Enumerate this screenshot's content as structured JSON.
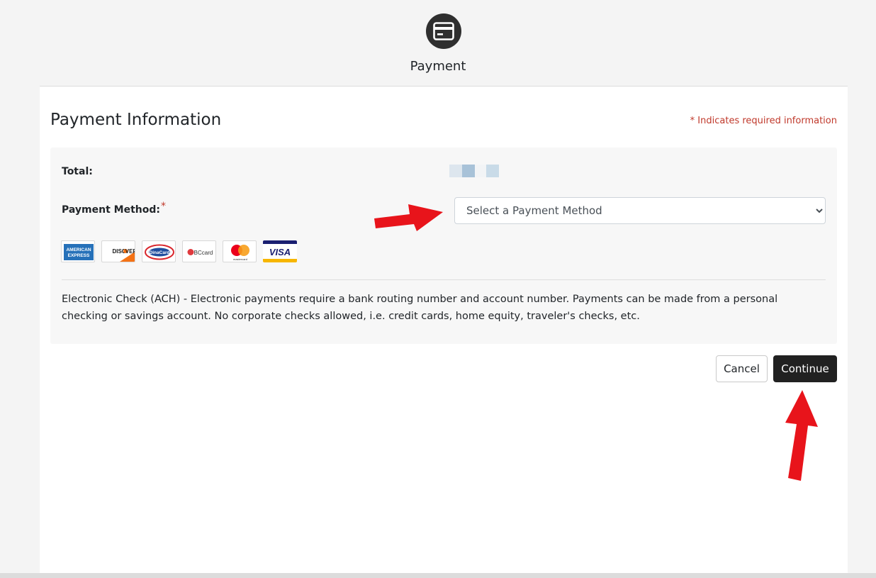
{
  "step": {
    "label": "Payment",
    "icon": "credit-card-icon"
  },
  "page": {
    "title": "Payment Information",
    "required_note": "* Indicates required information"
  },
  "payment": {
    "total_label": "Total:",
    "total_value": "",
    "method_label": "Payment Method:",
    "required_marker": "*",
    "select_placeholder": "Select a Payment Method",
    "accepted_cards": [
      "american-express",
      "discover",
      "dinacard",
      "bccard",
      "mastercard",
      "visa"
    ],
    "ach_note": "Electronic Check (ACH) - Electronic payments require a bank routing number and account number. Payments can be made from a personal checking or savings account. No corporate checks allowed, i.e. credit cards, home equity, traveler's checks, etc."
  },
  "actions": {
    "cancel_label": "Cancel",
    "continue_label": "Continue"
  },
  "colors": {
    "page_bg": "#f4f4f4",
    "panel_bg": "#f7f7f7",
    "required": "#c0392b",
    "primary_button": "#212121",
    "annotation_arrow": "#e8141b"
  }
}
